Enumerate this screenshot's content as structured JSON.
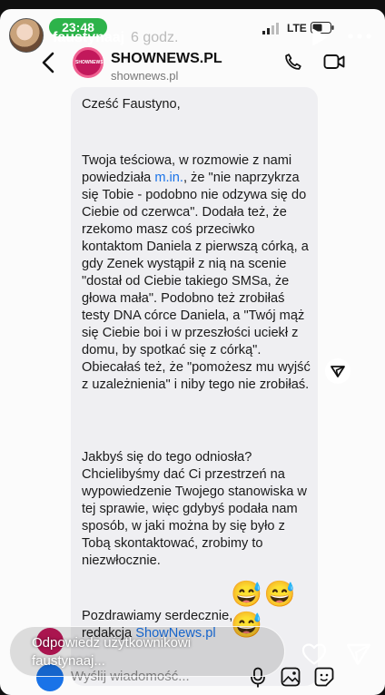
{
  "story": {
    "username": "faustynaaj",
    "time_ago": "6 godz.",
    "reply_placeholder": "Odpowiedz użytkownikowi faustynaaj..."
  },
  "status_bar": {
    "time": "23:48",
    "network": "LTE"
  },
  "chat": {
    "name": "SHOWNEWS.PL",
    "subtitle": "shownews.pl",
    "avatar_text": "SHOWNEWS",
    "input_placeholder": "Wyślij wiadomość..."
  },
  "message": {
    "greeting": "Cześć Faustyno,",
    "p1_a": "Twoja teściowa, w rozmowie z nami powiedziała ",
    "p1_link": "m.in.",
    "p1_b": ", że \"nie naprzykrza się Tobie - podobno nie odzywa się do Ciebie od czerwca\". Dodała też, że rzekomo masz coś przeciwko kontaktom Daniela z pierwszą córką, a gdy Zenek wystąpił z nią na scenie \"dostał od Ciebie takiego SMSa, że głowa mała\". Podobno też zrobiłaś testy DNA córce Daniela, a \"Twój mąż się Ciebie boi i w przeszłości uciekł z domu, by spotkać się z córką\". Obiecałaś też, że \"pomożesz mu wyjść z uzależnienia\" i niby tego nie zrobiłaś.",
    "p2": "Jakbyś się do tego odniosła? Chcielibyśmy dać Ci przestrzeń na wypowiedzenie Twojego stanowiska w tej sprawie, więc gdybyś podała nam sposób, w jaki można by się było z Tobą skontaktować, zrobimy to niezwłocznie.",
    "closing": "Pozdrawiamy serdecznie,",
    "sign_a": "redakcja ",
    "sign_link": "ShowNews.pl",
    "reactions": "😅😅😅"
  },
  "colors": {
    "link": "#1a73e8",
    "status_time_bg": "#2db34a",
    "brand": "#c2185b"
  },
  "icons": [
    "back-icon",
    "phone-icon",
    "video-icon",
    "share-icon",
    "mic-icon",
    "gallery-icon",
    "sticker-icon",
    "heart-icon",
    "send-icon",
    "play-icon",
    "more-icon"
  ]
}
